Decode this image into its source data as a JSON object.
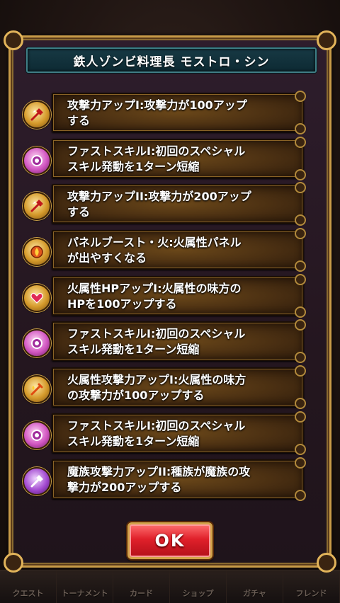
{
  "dialog": {
    "title": "鉄人ゾンビ料理長 モストロ・シン",
    "ok_label": "OK"
  },
  "skills": [
    {
      "icon": "attack-up-icon",
      "text": "攻撃力アップI:攻撃力が100アップ\nする"
    },
    {
      "icon": "fast-skill-icon",
      "text": "ファストスキルI:初回のスペシャル\nスキル発動を1ターン短縮"
    },
    {
      "icon": "attack-up-icon",
      "text": "攻撃力アップII:攻撃力が200アップ\nする"
    },
    {
      "icon": "panel-boost-fire-icon",
      "text": "パネルブースト・火:火属性パネル\nが出やすくなる"
    },
    {
      "icon": "hp-up-icon",
      "text": "火属性HPアップI:火属性の味方の\nHPを100アップする"
    },
    {
      "icon": "fast-skill-icon",
      "text": "ファストスキルI:初回のスペシャル\nスキル発動を1ターン短縮"
    },
    {
      "icon": "fire-attack-up-icon",
      "text": "火属性攻撃力アップI:火属性の味方\nの攻撃力が100アップする"
    },
    {
      "icon": "fast-skill-icon",
      "text": "ファストスキルI:初回のスペシャル\nスキル発動を1ターン短縮"
    },
    {
      "icon": "demon-attack-up-icon",
      "text": "魔族攻撃力アップII:種族が魔族の攻\n撃力が200アップする"
    }
  ],
  "colors": {
    "panel_border": "#c89b48",
    "title_bg": "#0d2a33",
    "ok_button": "#e0202a"
  },
  "background_tabs": [
    "クエスト",
    "トーナメント",
    "カード",
    "ショップ",
    "ガチャ",
    "フレンド"
  ]
}
